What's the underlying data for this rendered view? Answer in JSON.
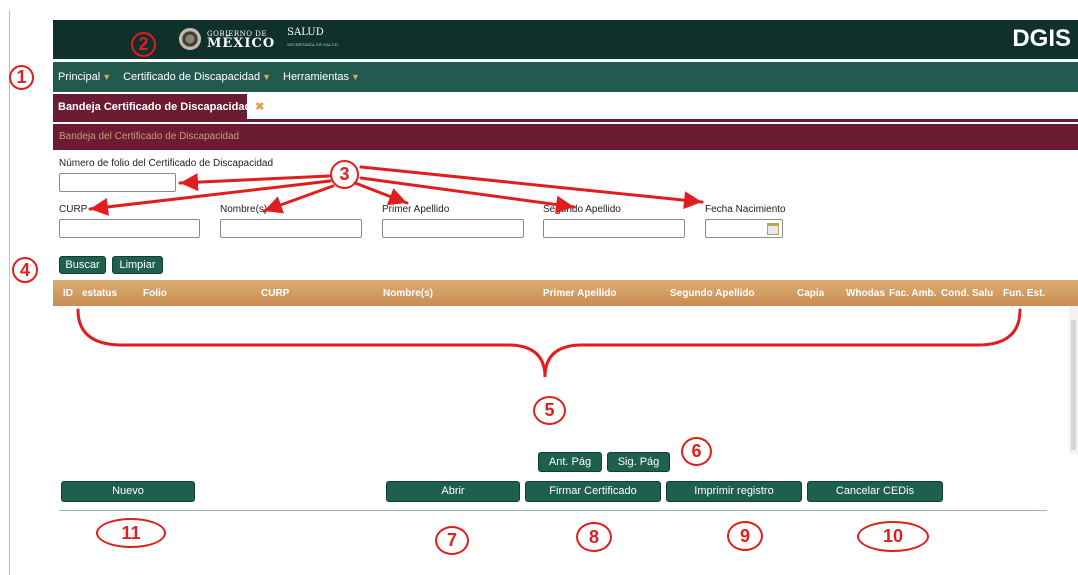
{
  "header": {
    "gov_small": "GOBIERNO DE",
    "gov_big": "MÉXICO",
    "salud": "SALUD",
    "salud_sub": "SECRETARÍA DE SALUD",
    "dgis": "DGIS"
  },
  "menu": {
    "items": [
      "Principal",
      "Certificado de Discapacidad",
      "Herramientas"
    ]
  },
  "tab": {
    "label": "Bandeja Certificado de Discapacidad",
    "close": "✖"
  },
  "section": {
    "title": "Bandeja del Certificado de Discapacidad"
  },
  "form": {
    "folio_label": "Número de folio del Certificado de Discapacidad",
    "curp_label": "CURP",
    "nombres_label": "Nombre(s)",
    "primer_apellido_label": "Primer Apellido",
    "segundo_apellido_label": "Segundo Apellido",
    "fecha_nacimiento_label": "Fecha Nacimiento"
  },
  "buttons": {
    "buscar": "Buscar",
    "limpiar": "Limpiar",
    "ant_pag": "Ant. Pág",
    "sig_pag": "Sig. Pág",
    "nuevo": "Nuevo",
    "abrir": "Abrir",
    "firmar": "Firmar Certificado",
    "imprimir": "Imprimir registro",
    "cancelar": "Cancelar CEDis"
  },
  "table": {
    "columns": [
      "ID",
      "estatus",
      "Folio",
      "CURP",
      "Nombre(s)",
      "Primer Apellido",
      "Segundo Apellido",
      "Capia",
      "Whodas",
      "Fac. Amb.",
      "Cond. Salu",
      "Fun. Est."
    ]
  },
  "annotations": {
    "n1": "1",
    "n2": "2",
    "n3": "3",
    "n4": "4",
    "n5": "5",
    "n6": "6",
    "n7": "7",
    "n8": "8",
    "n9": "9",
    "n10": "10",
    "n11": "11",
    "color": "#e01e1e"
  },
  "colors": {
    "top": "#10302b",
    "menu": "#235a4f",
    "maroon": "#6b1c33",
    "button": "#1f5f4e",
    "table_header": "#d09a5f"
  }
}
